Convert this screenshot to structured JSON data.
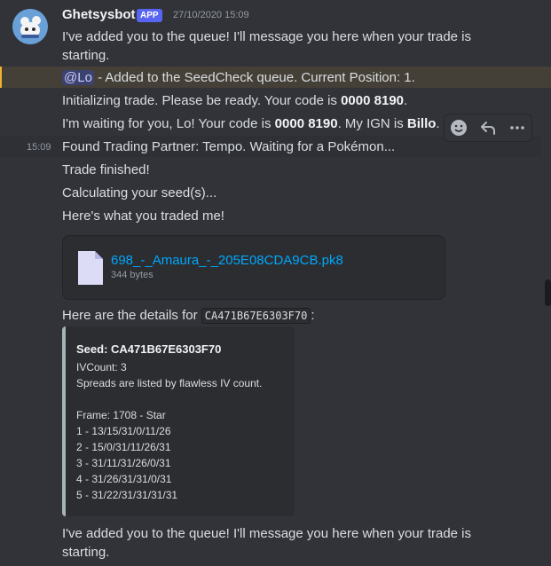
{
  "message": {
    "author": "Ghetsysbot",
    "badge": "APP",
    "timestamp": "27/10/2020 15:09",
    "side_time": "15:09",
    "lines": {
      "queue1_a": "I've added you to the queue! I'll message you here when your trade is",
      "queue1_b": "starting.",
      "mention": "@Lo",
      "mention_rest": " - Added to the SeedCheck queue. Current Position: 1.",
      "init_pre": "Initializing trade. Please be ready. Your code is ",
      "code": "0000 8190",
      "init_post": ".",
      "wait_pre": "I'm waiting for you, Lo! Your code is ",
      "wait_code": "0000 8190",
      "wait_mid": ". My IGN is ",
      "ign": "Billo",
      "wait_post": ".",
      "found": "Found Trading Partner: Tempo. Waiting for a Pokémon...",
      "finished": "Trade finished!",
      "calculating": "Calculating your seed(s)...",
      "traded": "Here's what you traded me!",
      "details_pre": "Here are the details for ",
      "details_code": "CA471B67E6303F70",
      "details_post": ":",
      "queue2_a": "I've added you to the queue! I'll message you here when your trade is",
      "queue2_b": "starting."
    },
    "attachment": {
      "icon": "file-icon",
      "name": "698_-_Amaura_-_205E08CDA9CB.pk8",
      "size": "344 bytes"
    },
    "embed": {
      "title": "Seed: CA471B67E6303F70",
      "lines": [
        "IVCount: 3",
        "Spreads are listed by flawless IV count.",
        "",
        "Frame: 1708 - Star",
        "1 - 13/15/31/0/11/26",
        "2 - 15/0/31/11/26/31",
        "3 - 31/11/31/26/0/31",
        "4 - 31/26/31/31/0/31",
        "5 - 31/22/31/31/31/31"
      ]
    }
  },
  "toolbar": {
    "icons": [
      "add-reaction-icon",
      "reply-icon",
      "more-icon"
    ]
  },
  "colors": {
    "background": "#313338",
    "mention_highlight": "#444037",
    "link": "#00a8fc",
    "badge": "#5865f2"
  }
}
